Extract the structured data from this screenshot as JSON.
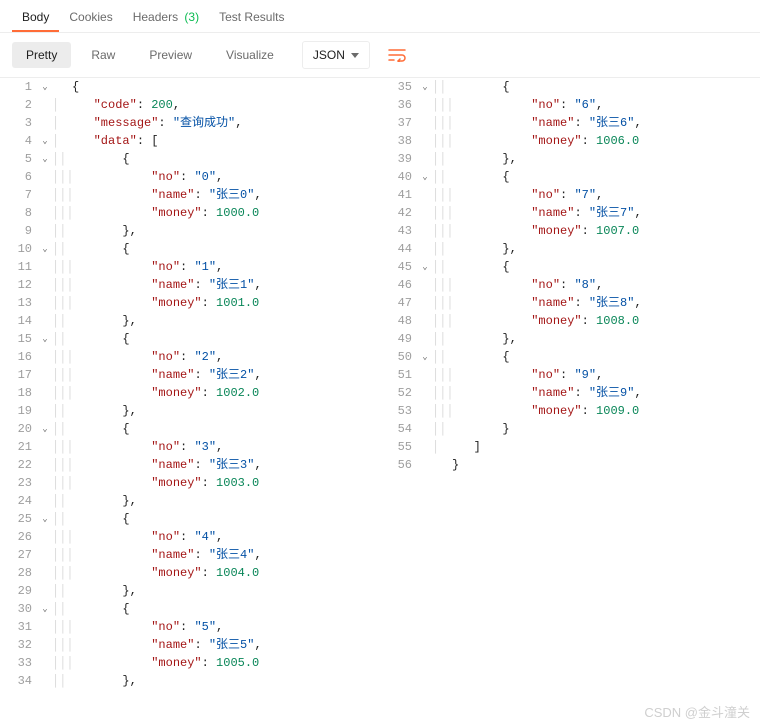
{
  "tabs": {
    "body": "Body",
    "cookies": "Cookies",
    "headers": "Headers",
    "headers_count": "(3)",
    "test_results": "Test Results"
  },
  "toolbar": {
    "pretty": "Pretty",
    "raw": "Raw",
    "preview": "Preview",
    "visualize": "Visualize",
    "format": "JSON"
  },
  "watermark": "CSDN @金斗潼关",
  "json_response": {
    "code": 200,
    "message": "查询成功",
    "data": [
      {
        "no": "0",
        "name": "张三0",
        "money": 1000.0
      },
      {
        "no": "1",
        "name": "张三1",
        "money": 1001.0
      },
      {
        "no": "2",
        "name": "张三2",
        "money": 1002.0
      },
      {
        "no": "3",
        "name": "张三3",
        "money": 1003.0
      },
      {
        "no": "4",
        "name": "张三4",
        "money": 1004.0
      },
      {
        "no": "5",
        "name": "张三5",
        "money": 1005.0
      },
      {
        "no": "6",
        "name": "张三6",
        "money": 1006.0
      },
      {
        "no": "7",
        "name": "张三7",
        "money": 1007.0
      },
      {
        "no": "8",
        "name": "张三8",
        "money": 1008.0
      },
      {
        "no": "9",
        "name": "张三9",
        "money": 1009.0
      }
    ]
  },
  "lines_left": [
    {
      "ln": 1,
      "fold": "v",
      "rules": "",
      "tokens": [
        [
          "p",
          "{"
        ]
      ]
    },
    {
      "ln": 2,
      "fold": "",
      "rules": "│",
      "tokens": [
        [
          "p",
          "   "
        ],
        [
          "k",
          "\"code\""
        ],
        [
          "p",
          ": "
        ],
        [
          "n",
          "200"
        ],
        [
          "p",
          ","
        ]
      ]
    },
    {
      "ln": 3,
      "fold": "",
      "rules": "│",
      "tokens": [
        [
          "p",
          "   "
        ],
        [
          "k",
          "\"message\""
        ],
        [
          "p",
          ": "
        ],
        [
          "s",
          "\"查询成功\""
        ],
        [
          "p",
          ","
        ]
      ]
    },
    {
      "ln": 4,
      "fold": "v",
      "rules": "│",
      "tokens": [
        [
          "p",
          "   "
        ],
        [
          "k",
          "\"data\""
        ],
        [
          "p",
          ": ["
        ]
      ]
    },
    {
      "ln": 5,
      "fold": "v",
      "rules": "││",
      "tokens": [
        [
          "p",
          "       {"
        ]
      ]
    },
    {
      "ln": 6,
      "fold": "",
      "rules": "│││",
      "tokens": [
        [
          "p",
          "           "
        ],
        [
          "k",
          "\"no\""
        ],
        [
          "p",
          ": "
        ],
        [
          "s",
          "\"0\""
        ],
        [
          "p",
          ","
        ]
      ]
    },
    {
      "ln": 7,
      "fold": "",
      "rules": "│││",
      "tokens": [
        [
          "p",
          "           "
        ],
        [
          "k",
          "\"name\""
        ],
        [
          "p",
          ": "
        ],
        [
          "s",
          "\"张三0\""
        ],
        [
          "p",
          ","
        ]
      ]
    },
    {
      "ln": 8,
      "fold": "",
      "rules": "│││",
      "tokens": [
        [
          "p",
          "           "
        ],
        [
          "k",
          "\"money\""
        ],
        [
          "p",
          ": "
        ],
        [
          "n",
          "1000.0"
        ]
      ]
    },
    {
      "ln": 9,
      "fold": "",
      "rules": "││",
      "tokens": [
        [
          "p",
          "       },"
        ]
      ]
    },
    {
      "ln": 10,
      "fold": "v",
      "rules": "││",
      "tokens": [
        [
          "p",
          "       {"
        ]
      ]
    },
    {
      "ln": 11,
      "fold": "",
      "rules": "│││",
      "tokens": [
        [
          "p",
          "           "
        ],
        [
          "k",
          "\"no\""
        ],
        [
          "p",
          ": "
        ],
        [
          "s",
          "\"1\""
        ],
        [
          "p",
          ","
        ]
      ]
    },
    {
      "ln": 12,
      "fold": "",
      "rules": "│││",
      "tokens": [
        [
          "p",
          "           "
        ],
        [
          "k",
          "\"name\""
        ],
        [
          "p",
          ": "
        ],
        [
          "s",
          "\"张三1\""
        ],
        [
          "p",
          ","
        ]
      ]
    },
    {
      "ln": 13,
      "fold": "",
      "rules": "│││",
      "tokens": [
        [
          "p",
          "           "
        ],
        [
          "k",
          "\"money\""
        ],
        [
          "p",
          ": "
        ],
        [
          "n",
          "1001.0"
        ]
      ]
    },
    {
      "ln": 14,
      "fold": "",
      "rules": "││",
      "tokens": [
        [
          "p",
          "       },"
        ]
      ]
    },
    {
      "ln": 15,
      "fold": "v",
      "rules": "││",
      "tokens": [
        [
          "p",
          "       {"
        ]
      ]
    },
    {
      "ln": 16,
      "fold": "",
      "rules": "│││",
      "tokens": [
        [
          "p",
          "           "
        ],
        [
          "k",
          "\"no\""
        ],
        [
          "p",
          ": "
        ],
        [
          "s",
          "\"2\""
        ],
        [
          "p",
          ","
        ]
      ]
    },
    {
      "ln": 17,
      "fold": "",
      "rules": "│││",
      "tokens": [
        [
          "p",
          "           "
        ],
        [
          "k",
          "\"name\""
        ],
        [
          "p",
          ": "
        ],
        [
          "s",
          "\"张三2\""
        ],
        [
          "p",
          ","
        ]
      ]
    },
    {
      "ln": 18,
      "fold": "",
      "rules": "│││",
      "tokens": [
        [
          "p",
          "           "
        ],
        [
          "k",
          "\"money\""
        ],
        [
          "p",
          ": "
        ],
        [
          "n",
          "1002.0"
        ]
      ]
    },
    {
      "ln": 19,
      "fold": "",
      "rules": "││",
      "tokens": [
        [
          "p",
          "       },"
        ]
      ]
    },
    {
      "ln": 20,
      "fold": "v",
      "rules": "││",
      "tokens": [
        [
          "p",
          "       {"
        ]
      ]
    },
    {
      "ln": 21,
      "fold": "",
      "rules": "│││",
      "tokens": [
        [
          "p",
          "           "
        ],
        [
          "k",
          "\"no\""
        ],
        [
          "p",
          ": "
        ],
        [
          "s",
          "\"3\""
        ],
        [
          "p",
          ","
        ]
      ]
    },
    {
      "ln": 22,
      "fold": "",
      "rules": "│││",
      "tokens": [
        [
          "p",
          "           "
        ],
        [
          "k",
          "\"name\""
        ],
        [
          "p",
          ": "
        ],
        [
          "s",
          "\"张三3\""
        ],
        [
          "p",
          ","
        ]
      ]
    },
    {
      "ln": 23,
      "fold": "",
      "rules": "│││",
      "tokens": [
        [
          "p",
          "           "
        ],
        [
          "k",
          "\"money\""
        ],
        [
          "p",
          ": "
        ],
        [
          "n",
          "1003.0"
        ]
      ]
    },
    {
      "ln": 24,
      "fold": "",
      "rules": "││",
      "tokens": [
        [
          "p",
          "       },"
        ]
      ]
    },
    {
      "ln": 25,
      "fold": "v",
      "rules": "││",
      "tokens": [
        [
          "p",
          "       {"
        ]
      ]
    },
    {
      "ln": 26,
      "fold": "",
      "rules": "│││",
      "tokens": [
        [
          "p",
          "           "
        ],
        [
          "k",
          "\"no\""
        ],
        [
          "p",
          ": "
        ],
        [
          "s",
          "\"4\""
        ],
        [
          "p",
          ","
        ]
      ]
    },
    {
      "ln": 27,
      "fold": "",
      "rules": "│││",
      "tokens": [
        [
          "p",
          "           "
        ],
        [
          "k",
          "\"name\""
        ],
        [
          "p",
          ": "
        ],
        [
          "s",
          "\"张三4\""
        ],
        [
          "p",
          ","
        ]
      ]
    },
    {
      "ln": 28,
      "fold": "",
      "rules": "│││",
      "tokens": [
        [
          "p",
          "           "
        ],
        [
          "k",
          "\"money\""
        ],
        [
          "p",
          ": "
        ],
        [
          "n",
          "1004.0"
        ]
      ]
    },
    {
      "ln": 29,
      "fold": "",
      "rules": "││",
      "tokens": [
        [
          "p",
          "       },"
        ]
      ]
    },
    {
      "ln": 30,
      "fold": "v",
      "rules": "││",
      "tokens": [
        [
          "p",
          "       {"
        ]
      ]
    },
    {
      "ln": 31,
      "fold": "",
      "rules": "│││",
      "tokens": [
        [
          "p",
          "           "
        ],
        [
          "k",
          "\"no\""
        ],
        [
          "p",
          ": "
        ],
        [
          "s",
          "\"5\""
        ],
        [
          "p",
          ","
        ]
      ]
    },
    {
      "ln": 32,
      "fold": "",
      "rules": "│││",
      "tokens": [
        [
          "p",
          "           "
        ],
        [
          "k",
          "\"name\""
        ],
        [
          "p",
          ": "
        ],
        [
          "s",
          "\"张三5\""
        ],
        [
          "p",
          ","
        ]
      ]
    },
    {
      "ln": 33,
      "fold": "",
      "rules": "│││",
      "tokens": [
        [
          "p",
          "           "
        ],
        [
          "k",
          "\"money\""
        ],
        [
          "p",
          ": "
        ],
        [
          "n",
          "1005.0"
        ]
      ]
    },
    {
      "ln": 34,
      "fold": "",
      "rules": "││",
      "tokens": [
        [
          "p",
          "       },"
        ]
      ]
    }
  ],
  "lines_right": [
    {
      "ln": 35,
      "fold": "v",
      "rules": "││",
      "tokens": [
        [
          "p",
          "       {"
        ]
      ]
    },
    {
      "ln": 36,
      "fold": "",
      "rules": "│││",
      "tokens": [
        [
          "p",
          "           "
        ],
        [
          "k",
          "\"no\""
        ],
        [
          "p",
          ": "
        ],
        [
          "s",
          "\"6\""
        ],
        [
          "p",
          ","
        ]
      ]
    },
    {
      "ln": 37,
      "fold": "",
      "rules": "│││",
      "tokens": [
        [
          "p",
          "           "
        ],
        [
          "k",
          "\"name\""
        ],
        [
          "p",
          ": "
        ],
        [
          "s",
          "\"张三6\""
        ],
        [
          "p",
          ","
        ]
      ]
    },
    {
      "ln": 38,
      "fold": "",
      "rules": "│││",
      "tokens": [
        [
          "p",
          "           "
        ],
        [
          "k",
          "\"money\""
        ],
        [
          "p",
          ": "
        ],
        [
          "n",
          "1006.0"
        ]
      ]
    },
    {
      "ln": 39,
      "fold": "",
      "rules": "││",
      "tokens": [
        [
          "p",
          "       },"
        ]
      ]
    },
    {
      "ln": 40,
      "fold": "v",
      "rules": "││",
      "tokens": [
        [
          "p",
          "       {"
        ]
      ]
    },
    {
      "ln": 41,
      "fold": "",
      "rules": "│││",
      "tokens": [
        [
          "p",
          "           "
        ],
        [
          "k",
          "\"no\""
        ],
        [
          "p",
          ": "
        ],
        [
          "s",
          "\"7\""
        ],
        [
          "p",
          ","
        ]
      ]
    },
    {
      "ln": 42,
      "fold": "",
      "rules": "│││",
      "tokens": [
        [
          "p",
          "           "
        ],
        [
          "k",
          "\"name\""
        ],
        [
          "p",
          ": "
        ],
        [
          "s",
          "\"张三7\""
        ],
        [
          "p",
          ","
        ]
      ]
    },
    {
      "ln": 43,
      "fold": "",
      "rules": "│││",
      "tokens": [
        [
          "p",
          "           "
        ],
        [
          "k",
          "\"money\""
        ],
        [
          "p",
          ": "
        ],
        [
          "n",
          "1007.0"
        ]
      ]
    },
    {
      "ln": 44,
      "fold": "",
      "rules": "││",
      "tokens": [
        [
          "p",
          "       },"
        ]
      ]
    },
    {
      "ln": 45,
      "fold": "v",
      "rules": "││",
      "tokens": [
        [
          "p",
          "       {"
        ]
      ]
    },
    {
      "ln": 46,
      "fold": "",
      "rules": "│││",
      "tokens": [
        [
          "p",
          "           "
        ],
        [
          "k",
          "\"no\""
        ],
        [
          "p",
          ": "
        ],
        [
          "s",
          "\"8\""
        ],
        [
          "p",
          ","
        ]
      ]
    },
    {
      "ln": 47,
      "fold": "",
      "rules": "│││",
      "tokens": [
        [
          "p",
          "           "
        ],
        [
          "k",
          "\"name\""
        ],
        [
          "p",
          ": "
        ],
        [
          "s",
          "\"张三8\""
        ],
        [
          "p",
          ","
        ]
      ]
    },
    {
      "ln": 48,
      "fold": "",
      "rules": "│││",
      "tokens": [
        [
          "p",
          "           "
        ],
        [
          "k",
          "\"money\""
        ],
        [
          "p",
          ": "
        ],
        [
          "n",
          "1008.0"
        ]
      ]
    },
    {
      "ln": 49,
      "fold": "",
      "rules": "││",
      "tokens": [
        [
          "p",
          "       },"
        ]
      ]
    },
    {
      "ln": 50,
      "fold": "v",
      "rules": "││",
      "tokens": [
        [
          "p",
          "       {"
        ]
      ]
    },
    {
      "ln": 51,
      "fold": "",
      "rules": "│││",
      "tokens": [
        [
          "p",
          "           "
        ],
        [
          "k",
          "\"no\""
        ],
        [
          "p",
          ": "
        ],
        [
          "s",
          "\"9\""
        ],
        [
          "p",
          ","
        ]
      ]
    },
    {
      "ln": 52,
      "fold": "",
      "rules": "│││",
      "tokens": [
        [
          "p",
          "           "
        ],
        [
          "k",
          "\"name\""
        ],
        [
          "p",
          ": "
        ],
        [
          "s",
          "\"张三9\""
        ],
        [
          "p",
          ","
        ]
      ]
    },
    {
      "ln": 53,
      "fold": "",
      "rules": "│││",
      "tokens": [
        [
          "p",
          "           "
        ],
        [
          "k",
          "\"money\""
        ],
        [
          "p",
          ": "
        ],
        [
          "n",
          "1009.0"
        ]
      ]
    },
    {
      "ln": 54,
      "fold": "",
      "rules": "││",
      "tokens": [
        [
          "p",
          "       }"
        ]
      ]
    },
    {
      "ln": 55,
      "fold": "",
      "rules": "│",
      "tokens": [
        [
          "p",
          "   ]"
        ]
      ]
    },
    {
      "ln": 56,
      "fold": "",
      "rules": "",
      "tokens": [
        [
          "p",
          "}"
        ]
      ]
    }
  ]
}
